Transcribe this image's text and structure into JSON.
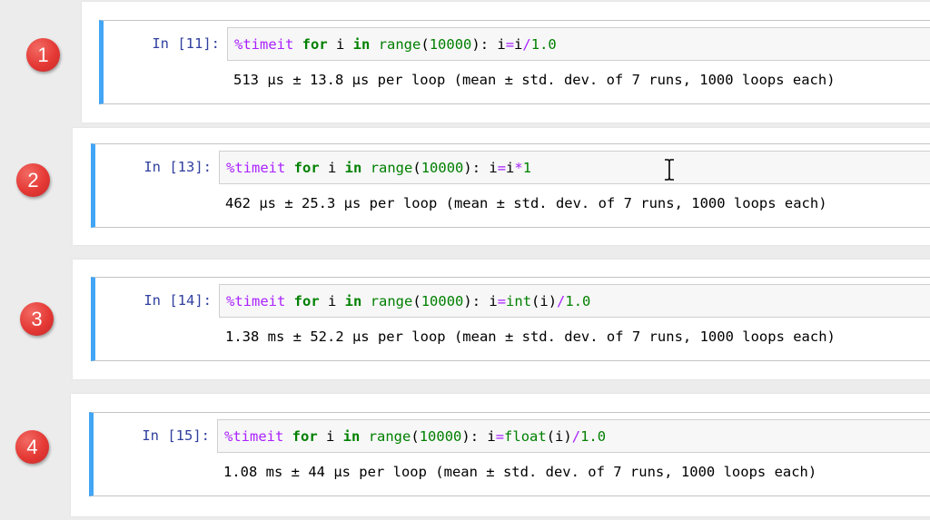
{
  "cells": [
    {
      "badge": "1",
      "prompt": "In [11]:",
      "tokens": [
        {
          "t": "%timeit",
          "c": "magic"
        },
        {
          "t": " ",
          "c": ""
        },
        {
          "t": "for",
          "c": "kw"
        },
        {
          "t": " i ",
          "c": ""
        },
        {
          "t": "in",
          "c": "kw"
        },
        {
          "t": " ",
          "c": ""
        },
        {
          "t": "range",
          "c": "fn"
        },
        {
          "t": "(",
          "c": ""
        },
        {
          "t": "10000",
          "c": "num"
        },
        {
          "t": "): i",
          "c": ""
        },
        {
          "t": "=",
          "c": "op"
        },
        {
          "t": "i",
          "c": ""
        },
        {
          "t": "/",
          "c": "op"
        },
        {
          "t": "1.0",
          "c": "num"
        }
      ],
      "output": "513 µs ± 13.8 µs per loop (mean ± std. dev. of 7 runs, 1000 loops each)"
    },
    {
      "badge": "2",
      "prompt": "In [13]:",
      "tokens": [
        {
          "t": "%timeit",
          "c": "magic"
        },
        {
          "t": " ",
          "c": ""
        },
        {
          "t": "for",
          "c": "kw"
        },
        {
          "t": " i ",
          "c": ""
        },
        {
          "t": "in",
          "c": "kw"
        },
        {
          "t": " ",
          "c": ""
        },
        {
          "t": "range",
          "c": "fn"
        },
        {
          "t": "(",
          "c": ""
        },
        {
          "t": "10000",
          "c": "num"
        },
        {
          "t": "): i",
          "c": ""
        },
        {
          "t": "=",
          "c": "op"
        },
        {
          "t": "i",
          "c": ""
        },
        {
          "t": "*",
          "c": "op"
        },
        {
          "t": "1",
          "c": "num"
        }
      ],
      "output": "462 µs ± 25.3 µs per loop (mean ± std. dev. of 7 runs, 1000 loops each)"
    },
    {
      "badge": "3",
      "prompt": "In [14]:",
      "tokens": [
        {
          "t": "%timeit",
          "c": "magic"
        },
        {
          "t": " ",
          "c": ""
        },
        {
          "t": "for",
          "c": "kw"
        },
        {
          "t": " i ",
          "c": ""
        },
        {
          "t": "in",
          "c": "kw"
        },
        {
          "t": " ",
          "c": ""
        },
        {
          "t": "range",
          "c": "fn"
        },
        {
          "t": "(",
          "c": ""
        },
        {
          "t": "10000",
          "c": "num"
        },
        {
          "t": "): i",
          "c": ""
        },
        {
          "t": "=",
          "c": "op"
        },
        {
          "t": "int",
          "c": "fn"
        },
        {
          "t": "(i)",
          "c": ""
        },
        {
          "t": "/",
          "c": "op"
        },
        {
          "t": "1.0",
          "c": "num"
        }
      ],
      "output": "1.38 ms ± 52.2 µs per loop (mean ± std. dev. of 7 runs, 1000 loops each)"
    },
    {
      "badge": "4",
      "prompt": "In [15]:",
      "tokens": [
        {
          "t": "%timeit",
          "c": "magic"
        },
        {
          "t": " ",
          "c": ""
        },
        {
          "t": "for",
          "c": "kw"
        },
        {
          "t": " i ",
          "c": ""
        },
        {
          "t": "in",
          "c": "kw"
        },
        {
          "t": " ",
          "c": ""
        },
        {
          "t": "range",
          "c": "fn"
        },
        {
          "t": "(",
          "c": ""
        },
        {
          "t": "10000",
          "c": "num"
        },
        {
          "t": "): i",
          "c": ""
        },
        {
          "t": "=",
          "c": "op"
        },
        {
          "t": "float",
          "c": "fn"
        },
        {
          "t": "(i)",
          "c": ""
        },
        {
          "t": "/",
          "c": "op"
        },
        {
          "t": "1.0",
          "c": "num"
        }
      ],
      "output": "1.08 ms ± 44 µs per loop (mean ± std. dev. of 7 runs, 1000 loops each)"
    }
  ],
  "colors": {
    "cell_accent": "#42a5f5",
    "prompt": "#303f9f",
    "magic": "#aa22ff",
    "keyword": "#008000",
    "badge": "#e53935"
  },
  "icons": {
    "cursor": "text-cursor-icon"
  }
}
